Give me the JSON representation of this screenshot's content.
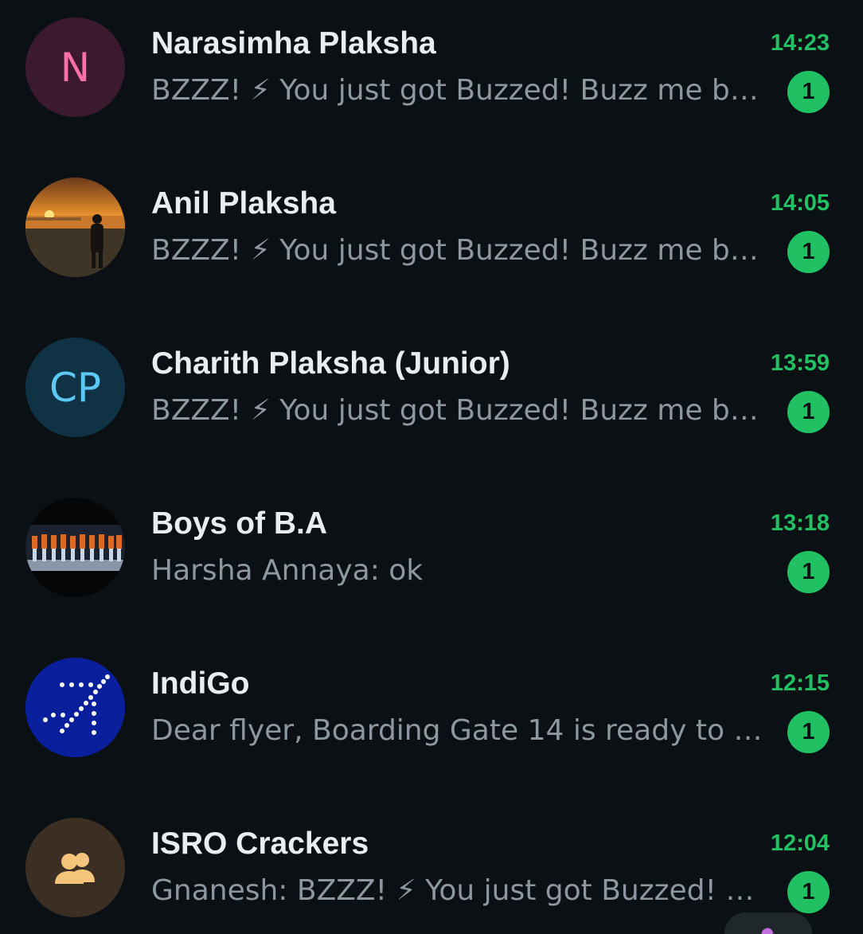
{
  "chats": [
    {
      "name": "Narasimha Plaksha",
      "time": "14:23",
      "preview": "BZZZ! ⚡ You just got Buzzed!  Buzz me back…",
      "unread": "1",
      "avatar": {
        "type": "initials",
        "text": "N",
        "bg": "#3a1a2c",
        "fg": "#ff6fa8"
      }
    },
    {
      "name": "Anil Plaksha",
      "time": "14:05",
      "preview": "BZZZ! ⚡ You just got Buzzed!  Buzz me back…",
      "unread": "1",
      "avatar": {
        "type": "photo",
        "icon": "sunset-photo-icon"
      }
    },
    {
      "name": "Charith Plaksha (Junior)",
      "time": "13:59",
      "preview": "BZZZ! ⚡ You just got Buzzed!  Buzz me back…",
      "unread": "1",
      "avatar": {
        "type": "initials",
        "text": "CP",
        "bg": "#0f3344",
        "fg": "#5cc8f4"
      }
    },
    {
      "name": "Boys of B.A",
      "time": "13:18",
      "preview": "Harsha Annaya: ok",
      "unread": "1",
      "avatar": {
        "type": "photo",
        "icon": "group-photo-icon"
      }
    },
    {
      "name": "IndiGo",
      "time": "12:15",
      "preview": "Dear flyer,  Boarding Gate 14 is ready to welcome you…",
      "unread": "1",
      "avatar": {
        "type": "logo",
        "icon": "indigo-logo-icon",
        "bg": "#0a1f9c"
      }
    },
    {
      "name": "ISRO Crackers",
      "time": "12:04",
      "preview": "Gnanesh: BZZZ! ⚡ You just got Buzzed!  Buzz me back…",
      "unread": "1",
      "avatar": {
        "type": "icon",
        "icon": "group-icon",
        "bg": "#3a2f22",
        "fg": "#f4c47a"
      }
    }
  ],
  "colors": {
    "background": "#0b1014",
    "accent": "#21c063",
    "name_text": "#e9edef",
    "preview_text": "#8d979e"
  }
}
